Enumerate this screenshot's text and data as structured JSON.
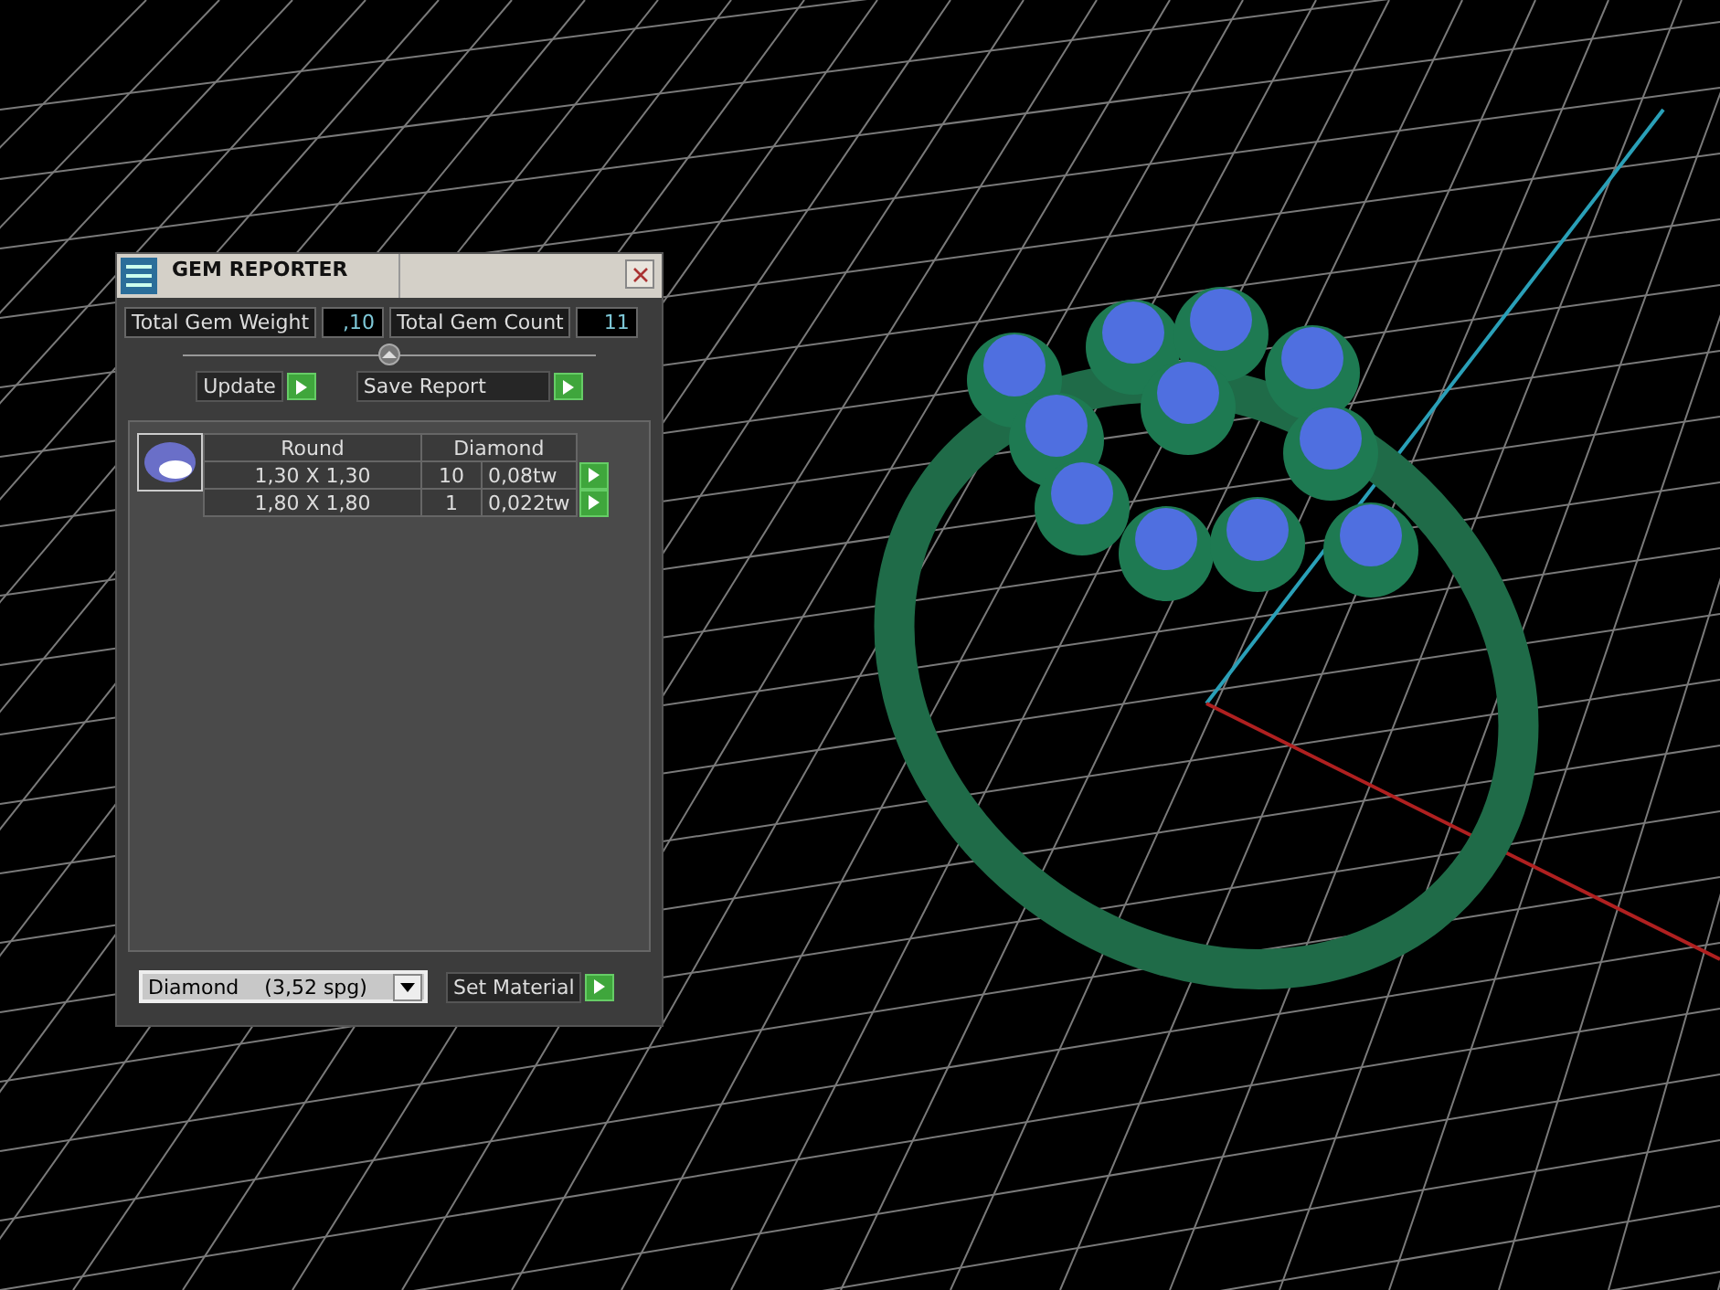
{
  "window": {
    "title": "GEM REPORTER"
  },
  "totals": [
    {
      "label": "Total Gem Weight",
      "value": ",10"
    },
    {
      "label": "Total Gem Count",
      "value": "11"
    }
  ],
  "buttons": [
    {
      "label": "Update"
    },
    {
      "label": "Save Report"
    }
  ],
  "table": {
    "columns": [
      "Round",
      "Diamond"
    ],
    "rows": [
      {
        "size": "1,30 X 1,30",
        "count": "10",
        "weight": "0,08tw"
      },
      {
        "size": "1,80 X 1,80",
        "count": "1",
        "weight": "0,022tw"
      }
    ]
  },
  "material": {
    "value": "Diamond",
    "density": "(3,52 spg)",
    "button": "Set Material"
  }
}
